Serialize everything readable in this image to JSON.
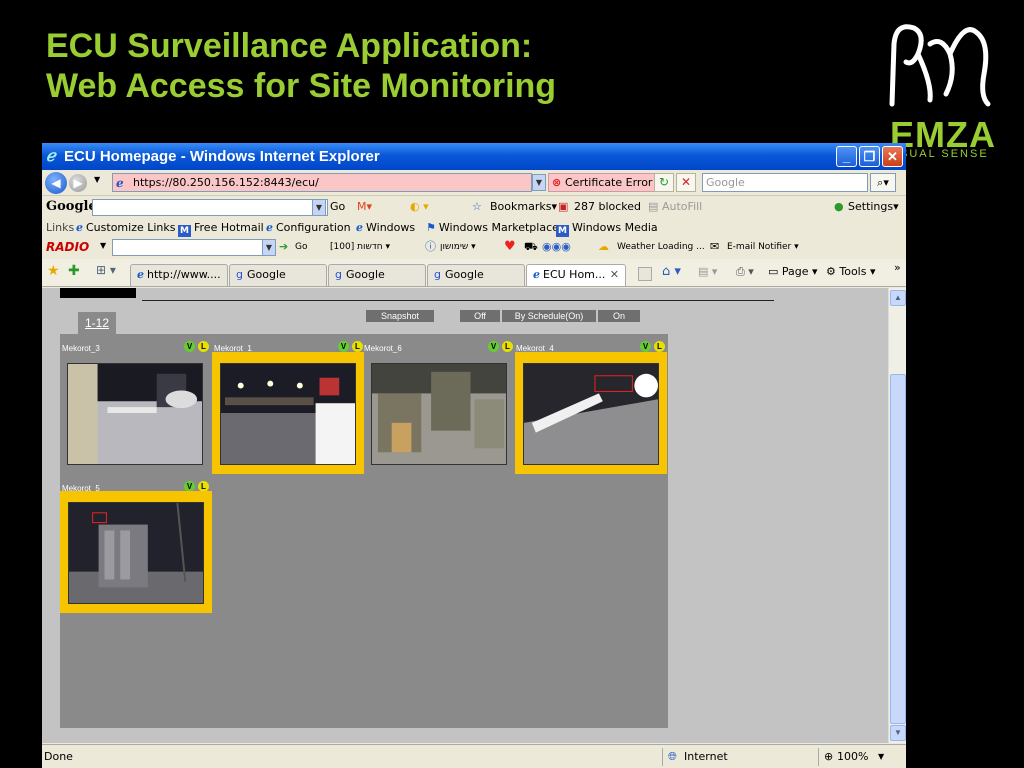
{
  "slide": {
    "title_line1": "ECU Surveillance Application:",
    "title_line2": "Web Access for Site Monitoring",
    "logo_word": "EMZA",
    "logo_tagline": "SUAL SENSE",
    "accent_color": "#9acd32"
  },
  "window": {
    "title": "ECU Homepage - Windows Internet Explorer",
    "minimize": "_",
    "restore": "❐",
    "close": "✕"
  },
  "address_bar": {
    "url": "https://80.250.156.152:8443/ecu/",
    "cert_error": "Certificate Error",
    "search_placeholder": "Google"
  },
  "google_toolbar": {
    "logo": "Google",
    "go": "Go",
    "bookmarks": "Bookmarks▾",
    "blocked": "287 blocked",
    "autofill": "AutoFill",
    "settings": "Settings▾"
  },
  "links_bar": {
    "label": "Links",
    "items": [
      "Customize Links",
      "Free Hotmail",
      "Configuration",
      "Windows",
      "Windows Marketplace",
      "Windows Media"
    ]
  },
  "radio_bar": {
    "logo": "RADIO",
    "go": "Go",
    "news": "חדשות [100]",
    "shopping": "שימושון",
    "weather": "Weather Loading ...",
    "email": "E-mail Notifier"
  },
  "tabs_bar": {
    "tabs": [
      "http://www....",
      "Google",
      "Google",
      "Google",
      "ECU Hom..."
    ],
    "page_menu": "Page",
    "tools_menu": "Tools"
  },
  "app": {
    "range_tab": "1-12",
    "snapshot": "Snapshot",
    "off": "Off",
    "schedule": "By Schedule(On)",
    "on": "On",
    "badge_v": "V",
    "badge_l": "L",
    "cameras": [
      {
        "label": "Mekorot_3",
        "highlighted": false
      },
      {
        "label": "Mekorot_1",
        "highlighted": true
      },
      {
        "label": "Mekorot_6",
        "highlighted": false
      },
      {
        "label": "Mekorot_4",
        "highlighted": true
      },
      {
        "label": "Mekorot_5",
        "highlighted": true
      }
    ]
  },
  "status_bar": {
    "status": "Done",
    "zone": "Internet",
    "zoom": "100%"
  }
}
